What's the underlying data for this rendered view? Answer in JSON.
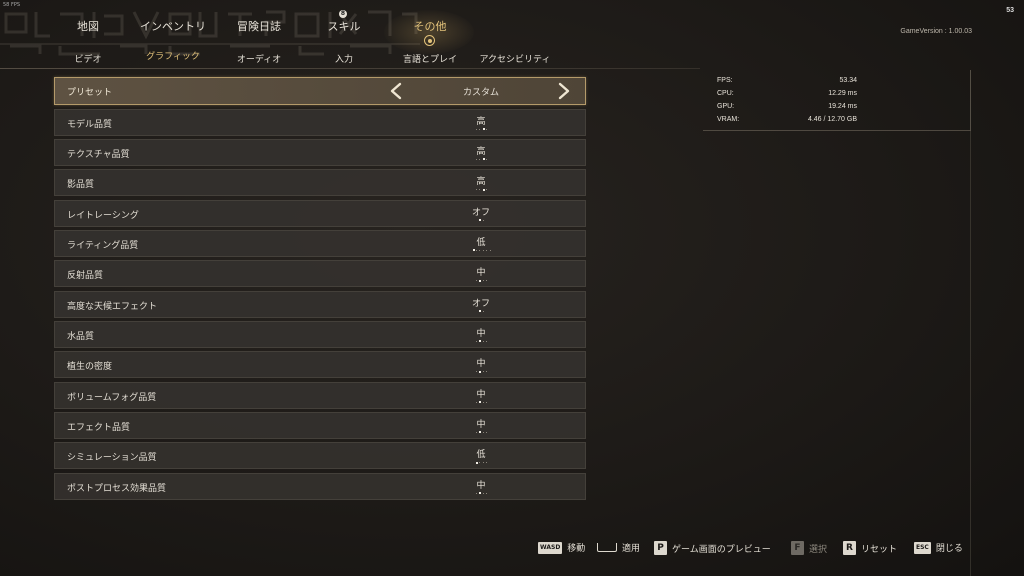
{
  "overlay": {
    "fps_small": "58 FPS",
    "fps_corner": "53"
  },
  "version": "GameVersion : 1.00.03",
  "main_tabs": [
    {
      "label": "地図",
      "active": false
    },
    {
      "label": "インベントリ",
      "active": false
    },
    {
      "label": "冒険日誌",
      "active": false
    },
    {
      "label": "スキル",
      "active": false
    },
    {
      "label": "その他",
      "active": true
    }
  ],
  "skill_badge": "8",
  "sub_tabs": [
    {
      "label": "ビデオ",
      "active": false
    },
    {
      "label": "グラフィック",
      "active": true
    },
    {
      "label": "オーディオ",
      "active": false
    },
    {
      "label": "入力",
      "active": false
    },
    {
      "label": "言語とプレイ",
      "active": false
    },
    {
      "label": "アクセシビリティ",
      "active": false
    }
  ],
  "preset": {
    "label": "プリセット",
    "value": "カスタム"
  },
  "settings": [
    {
      "label": "モデル品質",
      "value": "高",
      "steps": 4,
      "selected": 2
    },
    {
      "label": "テクスチャ品質",
      "value": "高",
      "steps": 4,
      "selected": 2
    },
    {
      "label": "影品質",
      "value": "高",
      "steps": 4,
      "selected": 2
    },
    {
      "label": "レイトレーシング",
      "value": "オフ",
      "steps": 2,
      "selected": 0
    },
    {
      "label": "ライティング品質",
      "value": "低",
      "steps": 6,
      "selected": 0
    },
    {
      "label": "反射品質",
      "value": "中",
      "steps": 4,
      "selected": 1
    },
    {
      "label": "高度な天候エフェクト",
      "value": "オフ",
      "steps": 2,
      "selected": 0
    },
    {
      "label": "水品質",
      "value": "中",
      "steps": 4,
      "selected": 1
    },
    {
      "label": "植生の密度",
      "value": "中",
      "steps": 4,
      "selected": 1
    },
    {
      "label": "ボリュームフォグ品質",
      "value": "中",
      "steps": 4,
      "selected": 1
    },
    {
      "label": "エフェクト品質",
      "value": "中",
      "steps": 4,
      "selected": 1
    },
    {
      "label": "シミュレーション品質",
      "value": "低",
      "steps": 4,
      "selected": 0
    },
    {
      "label": "ポストプロセス効果品質",
      "value": "中",
      "steps": 4,
      "selected": 1
    }
  ],
  "perf": [
    {
      "key": "FPS:",
      "value": "53.34"
    },
    {
      "key": "CPU:",
      "value": "12.29 ms"
    },
    {
      "key": "GPU:",
      "value": "19.24 ms"
    },
    {
      "key": "VRAM:",
      "value": "4.46 / 12.70 GB"
    }
  ],
  "footer": [
    {
      "key": "WASD",
      "label": "移動",
      "icon": "wasd-key-icon",
      "dim": false
    },
    {
      "key": "",
      "label": "適用",
      "icon": "spacebar-key-icon",
      "dim": false
    },
    {
      "key": "P",
      "label": "ゲーム画面のプレビュー",
      "icon": "p-key-icon",
      "dim": false
    },
    {
      "key": "F",
      "label": "選択",
      "icon": "f-key-icon",
      "dim": true
    },
    {
      "key": "R",
      "label": "リセット",
      "icon": "r-key-icon",
      "dim": false
    },
    {
      "key": "ESC",
      "label": "閉じる",
      "icon": "esc-key-icon",
      "dim": false
    }
  ],
  "colors": {
    "accent": "#e2c27a",
    "row_bg": "#34312e",
    "preset_border": "#b49a6a"
  }
}
